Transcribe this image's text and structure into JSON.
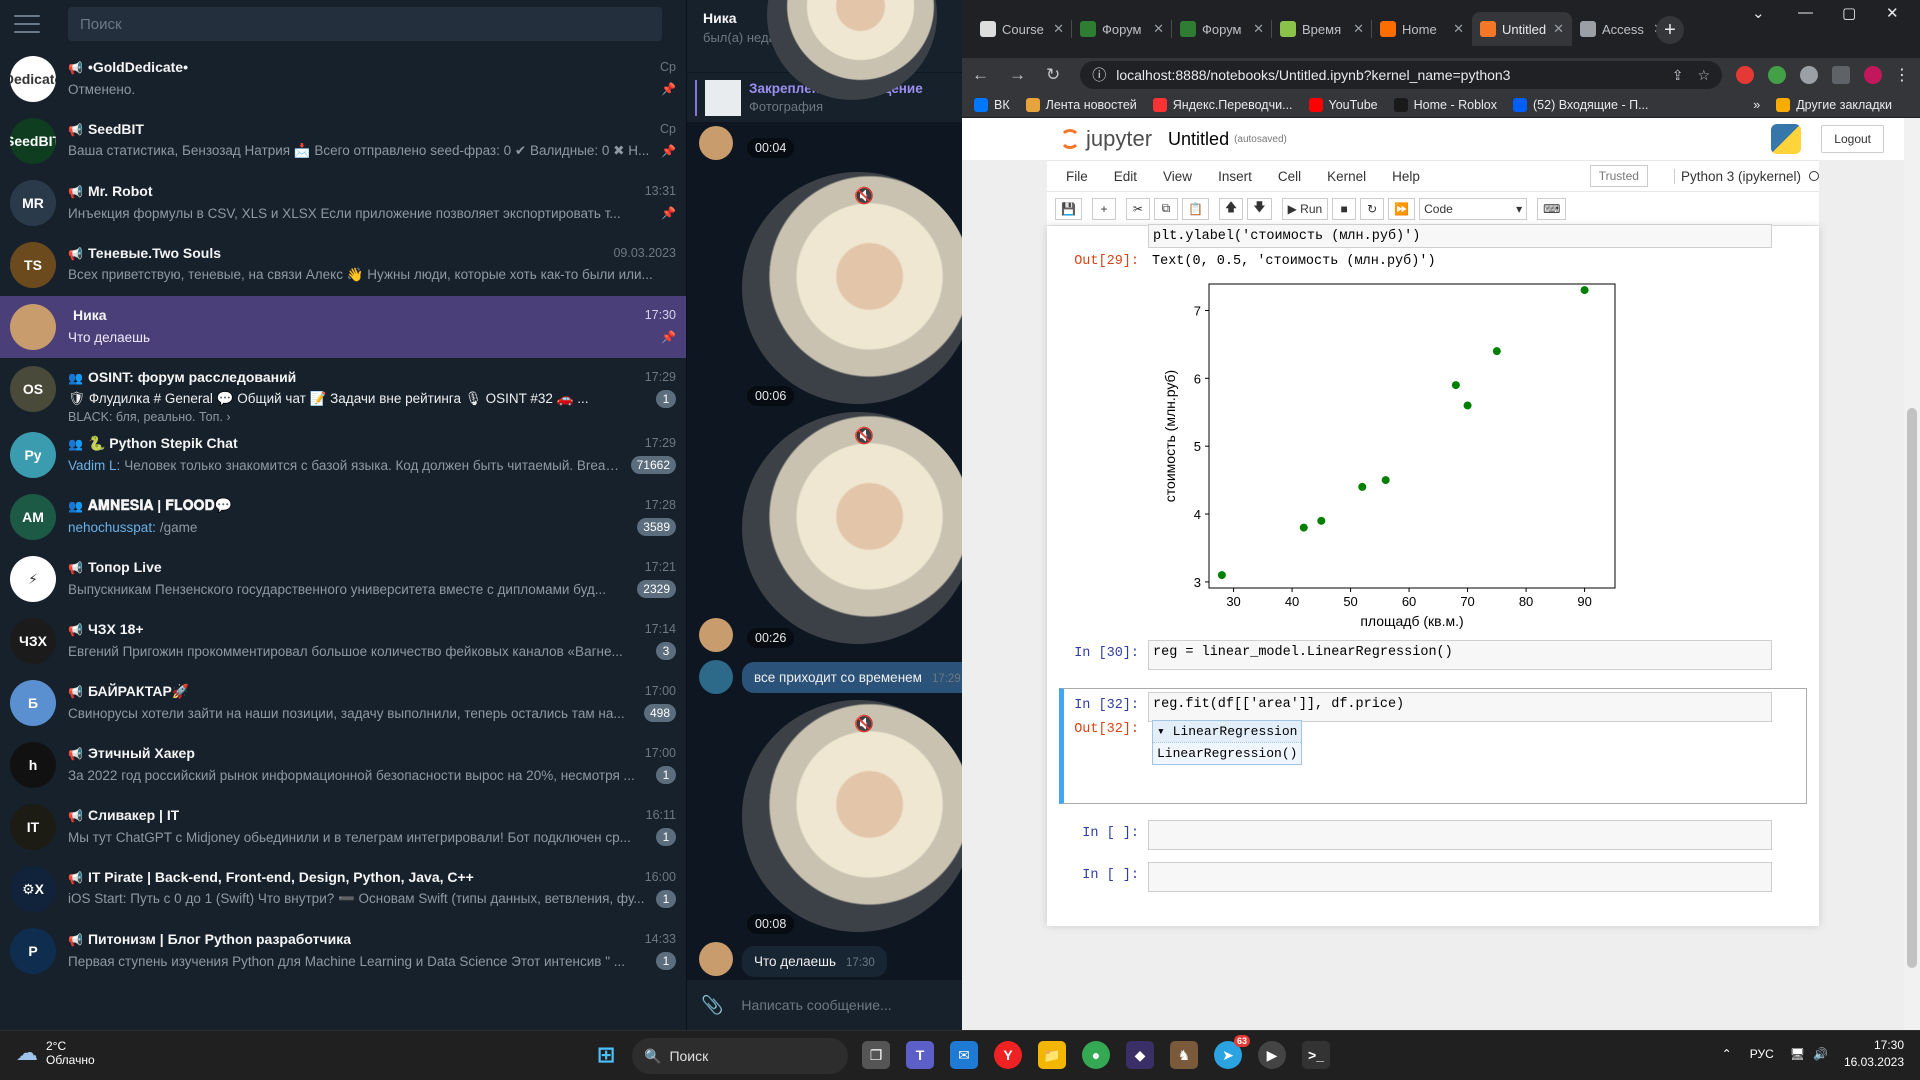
{
  "telegram": {
    "search_placeholder": "Поиск",
    "chats": [
      {
        "kind": "📢",
        "name": "•GoldDedicate•",
        "time": "Ср",
        "message": "Отменено.",
        "sender": "",
        "badge": "",
        "pinned": true,
        "active": false,
        "avatar_color": "#ffffff",
        "avatar_text": "Dedicate"
      },
      {
        "kind": "📢",
        "name": "SeedBIT",
        "time": "Ср",
        "message": "Ваша статистика, Бензозад Натрия 📩 Всего отправлено seed-фраз: 0 ✔ Валидные: 0 ✖ Н...",
        "sender": "",
        "badge": "",
        "pinned": true,
        "active": false,
        "avatar_color": "#0f3d1f",
        "avatar_text": "SeedBIT"
      },
      {
        "kind": "📢",
        "name": "Mr. Robot",
        "time": "13:31",
        "message": "Инъекция формулы в CSV, XLS и XLSX  Если приложение позволяет экспортировать т...",
        "sender": "",
        "badge": "",
        "pinned": true,
        "active": false,
        "avatar_color": "#2b3a4a",
        "avatar_text": "MR"
      },
      {
        "kind": "📢",
        "name": "Теневые.Two Souls",
        "time": "09.03.2023",
        "message": "Всех приветствую, теневые, на связи Алекс 👋  Нужны люди, которые хоть как-то были или...",
        "sender": "",
        "badge": "",
        "pinned": false,
        "active": false,
        "avatar_color": "#6b4a1e",
        "avatar_text": "TS"
      },
      {
        "kind": "",
        "name": "Ника",
        "time": "17:30",
        "message": "Что делаешь",
        "sender": "",
        "badge": "",
        "pinned": true,
        "active": true,
        "avatar_color": "#c89c6c",
        "avatar_text": ""
      },
      {
        "kind": "👥",
        "name": "OSINT: форум расследований",
        "time": "17:29",
        "message": "BLACK: бля, реально. Топ. ›",
        "sender": "",
        "badge": "1",
        "pinned": false,
        "active": false,
        "avatar_color": "#4a4a3a",
        "avatar_text": "OS",
        "topics": "🛡 Флудилка  # General  💬 Общий чат  📝 Задачи вне рейтинга  🎙 OSINT #32  🚗 ..."
      },
      {
        "kind": "👥",
        "name": "🐍 Python Stepik Chat",
        "time": "17:29",
        "message": "Человек только знакомится с базой языка. Код должен быть читаемый. Break ...",
        "sender": "Vadim L:",
        "badge": "71662",
        "pinned": false,
        "active": false,
        "avatar_color": "#3a9cae",
        "avatar_text": "Py"
      },
      {
        "kind": "👥",
        "name": "𝐀𝐌𝐍𝐄𝐒𝐈𝐀 | 𝐅𝐋𝐎𝐎𝐃💬",
        "time": "17:28",
        "message": "/game",
        "sender": "nehochusspat:",
        "badge": "3589",
        "pinned": false,
        "active": false,
        "avatar_color": "#1d5a45",
        "avatar_text": "AM"
      },
      {
        "kind": "📢",
        "name": "Топор Live",
        "time": "17:21",
        "message": "Выпускникам Пензенского государственного университета вместе с дипломами буд...",
        "sender": "",
        "badge": "2329",
        "pinned": false,
        "active": false,
        "avatar_color": "#ffffff",
        "avatar_text": "⚡"
      },
      {
        "kind": "📢",
        "name": "ЧЗХ 18+",
        "time": "17:14",
        "message": "Евгений Пригожин прокомментировал большое количество фейковых каналов «Вагне...",
        "sender": "",
        "badge": "3",
        "pinned": false,
        "active": false,
        "avatar_color": "#1b1b1b",
        "avatar_text": "ЧЗХ"
      },
      {
        "kind": "📢",
        "name": "БАЙРАКТАР🚀",
        "time": "17:00",
        "message": "Свинорусы хотели зайти на наши позиции, задачу выполнили, теперь остались там на...",
        "sender": "",
        "badge": "498",
        "pinned": false,
        "active": false,
        "avatar_color": "#5a8fd0",
        "avatar_text": "Б"
      },
      {
        "kind": "📢",
        "name": "Этичный Хакер",
        "time": "17:00",
        "message": "За 2022 год российский рынок информационной безопасности вырос на 20%, несмотря ...",
        "sender": "",
        "badge": "1",
        "pinned": false,
        "active": false,
        "avatar_color": "#111111",
        "avatar_text": "h"
      },
      {
        "kind": "📢",
        "name": "Сливакер | IT",
        "time": "16:11",
        "message": "Мы тут ChatGPT с Midjoney обьединили и в телеграм интегрировали!  Бот подключен ср...",
        "sender": "",
        "badge": "1",
        "pinned": false,
        "active": false,
        "avatar_color": "#1c1c14",
        "avatar_text": "IT"
      },
      {
        "kind": "📢",
        "name": "IT Pirate | Back-end, Front-end, Design, Python, Java, C++",
        "time": "16:00",
        "message": "iOS Start: Путь с 0 до 1 (Swift)  Что внутри?  ➖ Основам Swift (типы данных, ветвления, фу...",
        "sender": "",
        "badge": "1",
        "pinned": false,
        "active": false,
        "avatar_color": "#10233a",
        "avatar_text": "⚙X"
      },
      {
        "kind": "📢",
        "name": "Питонизм | Блог Python разработчика",
        "time": "14:33",
        "message": "Первая ступень изучения Python для Machine Learning и Data Science     Этот интенсив \" ...",
        "sender": "",
        "badge": "1",
        "pinned": false,
        "active": false,
        "avatar_color": "#0f2d4f",
        "avatar_text": "P"
      }
    ],
    "conversation": {
      "name": "Ника",
      "status": "был(а) недавно",
      "pinned_title": "Закреплённое сообщение",
      "pinned_sub": "Фотография",
      "video_times": [
        "00:04",
        "00:06",
        "00:26",
        "00:08"
      ],
      "text_msg": "все приходит со временем",
      "text_msg_time": "17:29",
      "last_msg": "Что делаешь",
      "last_msg_time": "17:30",
      "composer_placeholder": "Написать сообщение..."
    }
  },
  "browser": {
    "tabs": [
      {
        "label": "Course",
        "color": "#dddddd"
      },
      {
        "label": "Форум",
        "color": "#2e7d32"
      },
      {
        "label": "Форум",
        "color": "#2e7d32"
      },
      {
        "label": "Время",
        "color": "#8bc34a"
      },
      {
        "label": "Home",
        "color": "#ff6d00"
      },
      {
        "label": "Untitled",
        "color": "#f37726"
      },
      {
        "label": "Access",
        "color": "#9aa0a6"
      }
    ],
    "url": "localhost:8888/notebooks/Untitled.ipynb?kernel_name=python3",
    "bookmarks": [
      "ВК",
      "Лента новостей",
      "Яндекс.Переводчи...",
      "YouTube",
      "Home - Roblox",
      "(52) Входящие - П..."
    ],
    "bookmark_colors": [
      "#0077ff",
      "#e8a33c",
      "#ff3333",
      "#ff0000",
      "#1a1a1a",
      "#005ff9"
    ],
    "other_bookmarks": "Другие закладки",
    "overflow": "»"
  },
  "jupyter": {
    "logo": "jupyter",
    "notebook_name": "Untitled",
    "autosaved": "(autosaved)",
    "logout": "Logout",
    "menu": [
      "File",
      "Edit",
      "View",
      "Insert",
      "Cell",
      "Kernel",
      "Help"
    ],
    "trusted": "Trusted",
    "kernel": "Python 3 (ipykernel)",
    "run_label": "Run",
    "cell_type": "Code",
    "cells": {
      "prev_code": "plt.ylabel('стоимость (млн.руб)')",
      "out29_prompt": "Out[29]:",
      "out29_text": "Text(0, 0.5, 'стоимость (млн.руб)')",
      "in30_prompt": "In [30]:",
      "in30_code": "reg = linear_model.LinearRegression()",
      "in32_prompt": "In [32]:",
      "in32_code": "reg.fit(df[['area']], df.price)",
      "out32_prompt": "Out[32]:",
      "lr_header": "▾ LinearRegression",
      "lr_body": "LinearRegression()",
      "empty_prompt": "In [ ]:"
    }
  },
  "chart_data": {
    "type": "scatter",
    "title": "",
    "xlabel": "площадб (кв.м.)",
    "ylabel": "стоимость (млн.руб)",
    "xlim": [
      25.8,
      95.2
    ],
    "ylim": [
      2.91,
      7.39
    ],
    "xticks": [
      30,
      40,
      50,
      60,
      70,
      80,
      90
    ],
    "yticks": [
      3,
      4,
      5,
      6,
      7
    ],
    "color": "#008000",
    "points": [
      {
        "x": 28,
        "y": 3.1
      },
      {
        "x": 42,
        "y": 3.8
      },
      {
        "x": 45,
        "y": 3.9
      },
      {
        "x": 52,
        "y": 4.4
      },
      {
        "x": 56,
        "y": 4.5
      },
      {
        "x": 68,
        "y": 5.9
      },
      {
        "x": 70,
        "y": 5.6
      },
      {
        "x": 75,
        "y": 6.4
      },
      {
        "x": 90,
        "y": 7.3
      }
    ]
  },
  "taskbar": {
    "temperature": "2°C",
    "weather": "Облачно",
    "search": "Поиск",
    "lang": "РУС",
    "time": "17:30",
    "date": "16.03.2023",
    "telegram_badge": "63"
  }
}
